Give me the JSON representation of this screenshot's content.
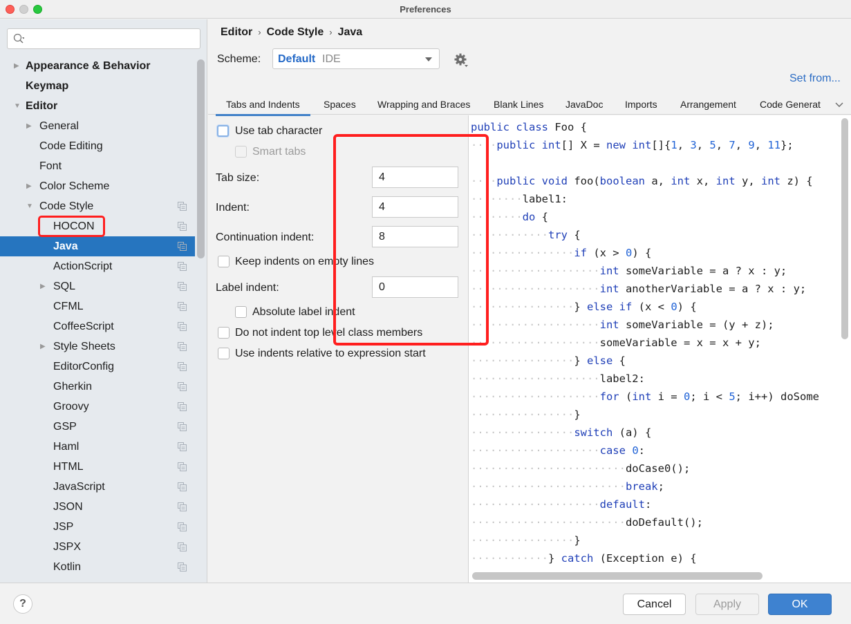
{
  "window": {
    "title": "Preferences"
  },
  "sidebar": {
    "search_placeholder": "",
    "items": [
      {
        "label": "Appearance & Behavior",
        "level": 0,
        "bold": true,
        "arrow": "right",
        "copy_icon": false
      },
      {
        "label": "Keymap",
        "level": 0,
        "bold": true,
        "arrow": "none",
        "copy_icon": false
      },
      {
        "label": "Editor",
        "level": 0,
        "bold": true,
        "arrow": "down",
        "copy_icon": false
      },
      {
        "label": "General",
        "level": 1,
        "bold": false,
        "arrow": "right",
        "copy_icon": false
      },
      {
        "label": "Code Editing",
        "level": 1,
        "bold": false,
        "arrow": "none",
        "copy_icon": false
      },
      {
        "label": "Font",
        "level": 1,
        "bold": false,
        "arrow": "none",
        "copy_icon": false
      },
      {
        "label": "Color Scheme",
        "level": 1,
        "bold": false,
        "arrow": "right",
        "copy_icon": false
      },
      {
        "label": "Code Style",
        "level": 1,
        "bold": false,
        "arrow": "down",
        "copy_icon": true
      },
      {
        "label": "HOCON",
        "level": 2,
        "bold": false,
        "arrow": "none",
        "copy_icon": true
      },
      {
        "label": "Java",
        "level": 2,
        "bold": true,
        "arrow": "none",
        "copy_icon": true,
        "selected": true
      },
      {
        "label": "ActionScript",
        "level": 2,
        "bold": false,
        "arrow": "none",
        "copy_icon": true
      },
      {
        "label": "SQL",
        "level": 2,
        "bold": false,
        "arrow": "right",
        "copy_icon": true
      },
      {
        "label": "CFML",
        "level": 2,
        "bold": false,
        "arrow": "none",
        "copy_icon": true
      },
      {
        "label": "CoffeeScript",
        "level": 2,
        "bold": false,
        "arrow": "none",
        "copy_icon": true
      },
      {
        "label": "Style Sheets",
        "level": 2,
        "bold": false,
        "arrow": "right",
        "copy_icon": true
      },
      {
        "label": "EditorConfig",
        "level": 2,
        "bold": false,
        "arrow": "none",
        "copy_icon": true
      },
      {
        "label": "Gherkin",
        "level": 2,
        "bold": false,
        "arrow": "none",
        "copy_icon": true
      },
      {
        "label": "Groovy",
        "level": 2,
        "bold": false,
        "arrow": "none",
        "copy_icon": true
      },
      {
        "label": "GSP",
        "level": 2,
        "bold": false,
        "arrow": "none",
        "copy_icon": true
      },
      {
        "label": "Haml",
        "level": 2,
        "bold": false,
        "arrow": "none",
        "copy_icon": true
      },
      {
        "label": "HTML",
        "level": 2,
        "bold": false,
        "arrow": "none",
        "copy_icon": true
      },
      {
        "label": "JavaScript",
        "level": 2,
        "bold": false,
        "arrow": "none",
        "copy_icon": true
      },
      {
        "label": "JSON",
        "level": 2,
        "bold": false,
        "arrow": "none",
        "copy_icon": true
      },
      {
        "label": "JSP",
        "level": 2,
        "bold": false,
        "arrow": "none",
        "copy_icon": true
      },
      {
        "label": "JSPX",
        "level": 2,
        "bold": false,
        "arrow": "none",
        "copy_icon": true
      },
      {
        "label": "Kotlin",
        "level": 2,
        "bold": false,
        "arrow": "none",
        "copy_icon": true
      }
    ]
  },
  "breadcrumb": [
    "Editor",
    "Code Style",
    "Java"
  ],
  "scheme": {
    "label": "Scheme:",
    "name": "Default",
    "qualifier": "IDE"
  },
  "set_from_link": "Set from...",
  "tabs": [
    {
      "label": "Tabs and Indents",
      "active": true
    },
    {
      "label": "Spaces"
    },
    {
      "label": "Wrapping and Braces"
    },
    {
      "label": "Blank Lines"
    },
    {
      "label": "JavaDoc"
    },
    {
      "label": "Imports"
    },
    {
      "label": "Arrangement"
    },
    {
      "label": "Code Generat"
    }
  ],
  "options": {
    "use_tab_character": {
      "label": "Use tab character",
      "checked": false
    },
    "smart_tabs": {
      "label": "Smart tabs",
      "checked": false,
      "disabled": true
    },
    "tab_size": {
      "label": "Tab size:",
      "value": "4"
    },
    "indent": {
      "label": "Indent:",
      "value": "4"
    },
    "continuation_indent": {
      "label": "Continuation indent:",
      "value": "8"
    },
    "keep_indents_empty": {
      "label": "Keep indents on empty lines",
      "checked": false
    },
    "label_indent": {
      "label": "Label indent:",
      "value": "0"
    },
    "absolute_label_indent": {
      "label": "Absolute label indent",
      "checked": false
    },
    "no_indent_top_level": {
      "label": "Do not indent top level class members",
      "checked": false
    },
    "relative_to_expression": {
      "label": "Use indents relative to expression start",
      "checked": false
    }
  },
  "code_preview": [
    [
      [
        "kw",
        "public"
      ],
      [
        "t",
        " "
      ],
      [
        "kw",
        "class"
      ],
      [
        "t",
        " Foo {"
      ]
    ],
    [
      [
        "ws",
        "····"
      ],
      [
        "kw",
        "public"
      ],
      [
        "t",
        " "
      ],
      [
        "kw",
        "int"
      ],
      [
        "t",
        "[] X = "
      ],
      [
        "kw",
        "new"
      ],
      [
        "t",
        " "
      ],
      [
        "kw",
        "int"
      ],
      [
        "t",
        "[]{"
      ],
      [
        "num",
        "1"
      ],
      [
        "t",
        ", "
      ],
      [
        "num",
        "3"
      ],
      [
        "t",
        ", "
      ],
      [
        "num",
        "5"
      ],
      [
        "t",
        ", "
      ],
      [
        "num",
        "7"
      ],
      [
        "t",
        ", "
      ],
      [
        "num",
        "9"
      ],
      [
        "t",
        ", "
      ],
      [
        "num",
        "11"
      ],
      [
        "t",
        "};"
      ]
    ],
    [
      [
        "t",
        ""
      ]
    ],
    [
      [
        "ws",
        "····"
      ],
      [
        "kw",
        "public"
      ],
      [
        "t",
        " "
      ],
      [
        "kw",
        "void"
      ],
      [
        "t",
        " foo("
      ],
      [
        "kw",
        "boolean"
      ],
      [
        "t",
        " a, "
      ],
      [
        "kw",
        "int"
      ],
      [
        "t",
        " x, "
      ],
      [
        "kw",
        "int"
      ],
      [
        "t",
        " y, "
      ],
      [
        "kw",
        "int"
      ],
      [
        "t",
        " z) {"
      ]
    ],
    [
      [
        "ws",
        "········"
      ],
      [
        "t",
        "label1:"
      ]
    ],
    [
      [
        "ws",
        "········"
      ],
      [
        "kw",
        "do"
      ],
      [
        "t",
        " {"
      ]
    ],
    [
      [
        "ws",
        "············"
      ],
      [
        "kw",
        "try"
      ],
      [
        "t",
        " {"
      ]
    ],
    [
      [
        "ws",
        "················"
      ],
      [
        "kw",
        "if"
      ],
      [
        "t",
        " (x > "
      ],
      [
        "num",
        "0"
      ],
      [
        "t",
        ") {"
      ]
    ],
    [
      [
        "ws",
        "····················"
      ],
      [
        "kw",
        "int"
      ],
      [
        "t",
        " someVariable = a ? x : y;"
      ]
    ],
    [
      [
        "ws",
        "····················"
      ],
      [
        "kw",
        "int"
      ],
      [
        "t",
        " anotherVariable = a ? x : y;"
      ]
    ],
    [
      [
        "ws",
        "················"
      ],
      [
        "t",
        "} "
      ],
      [
        "kw",
        "else if"
      ],
      [
        "t",
        " (x < "
      ],
      [
        "num",
        "0"
      ],
      [
        "t",
        ") {"
      ]
    ],
    [
      [
        "ws",
        "····················"
      ],
      [
        "kw",
        "int"
      ],
      [
        "t",
        " someVariable = (y + z);"
      ]
    ],
    [
      [
        "ws",
        "····················"
      ],
      [
        "t",
        "someVariable = x = x + y;"
      ]
    ],
    [
      [
        "ws",
        "················"
      ],
      [
        "t",
        "} "
      ],
      [
        "kw",
        "else"
      ],
      [
        "t",
        " {"
      ]
    ],
    [
      [
        "ws",
        "····················"
      ],
      [
        "t",
        "label2:"
      ]
    ],
    [
      [
        "ws",
        "····················"
      ],
      [
        "kw",
        "for"
      ],
      [
        "t",
        " ("
      ],
      [
        "kw",
        "int"
      ],
      [
        "t",
        " i = "
      ],
      [
        "num",
        "0"
      ],
      [
        "t",
        "; i < "
      ],
      [
        "num",
        "5"
      ],
      [
        "t",
        "; i++) doSome"
      ]
    ],
    [
      [
        "ws",
        "················"
      ],
      [
        "t",
        "}"
      ]
    ],
    [
      [
        "ws",
        "················"
      ],
      [
        "kw",
        "switch"
      ],
      [
        "t",
        " (a) {"
      ]
    ],
    [
      [
        "ws",
        "····················"
      ],
      [
        "kw",
        "case"
      ],
      [
        "t",
        " "
      ],
      [
        "num",
        "0"
      ],
      [
        "t",
        ":"
      ]
    ],
    [
      [
        "ws",
        "························"
      ],
      [
        "t",
        "doCase0();"
      ]
    ],
    [
      [
        "ws",
        "························"
      ],
      [
        "kw",
        "break"
      ],
      [
        "t",
        ";"
      ]
    ],
    [
      [
        "ws",
        "····················"
      ],
      [
        "kw",
        "default"
      ],
      [
        "t",
        ":"
      ]
    ],
    [
      [
        "ws",
        "························"
      ],
      [
        "t",
        "doDefault();"
      ]
    ],
    [
      [
        "ws",
        "················"
      ],
      [
        "t",
        "}"
      ]
    ],
    [
      [
        "ws",
        "············"
      ],
      [
        "t",
        "} "
      ],
      [
        "kw",
        "catch"
      ],
      [
        "t",
        " (Exception e) {"
      ]
    ]
  ],
  "buttons": {
    "help": "?",
    "cancel": "Cancel",
    "apply": "Apply",
    "ok": "OK"
  },
  "colors": {
    "accent": "#2675bf",
    "link": "#2b6cc4",
    "keyword": "#1f3fb7",
    "number": "#1f62d6",
    "annotation_red": "#ff1e1e",
    "ok_button": "#3e82d0"
  }
}
